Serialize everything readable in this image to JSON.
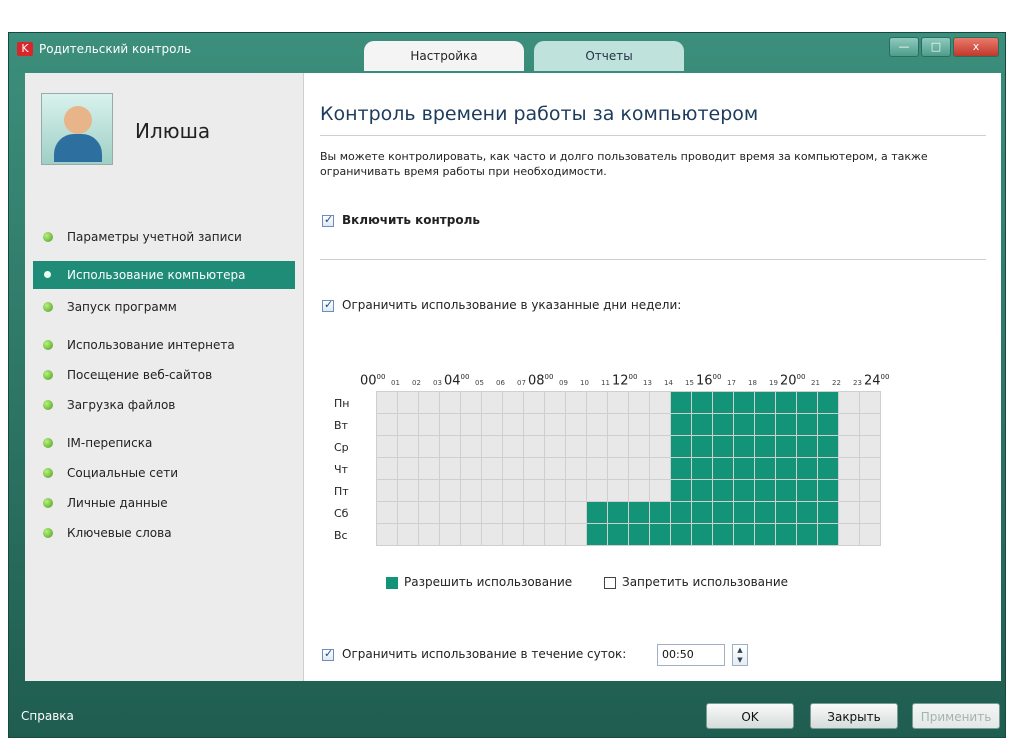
{
  "window": {
    "title": "Родительский контроль",
    "tabs": [
      {
        "label": "Настройка",
        "active": true
      },
      {
        "label": "Отчеты",
        "active": false
      }
    ],
    "buttons": {
      "minimize": "—",
      "maximize": "□",
      "close": "x"
    }
  },
  "sidebar": {
    "user_name": "Илюша",
    "items": [
      {
        "label": "Параметры учетной записи",
        "active": false
      },
      {
        "label": "Использование компьютера",
        "active": true
      },
      {
        "label": "Запуск программ",
        "active": false
      },
      {
        "label": "Использование интернета",
        "active": false
      },
      {
        "label": "Посещение веб-сайтов",
        "active": false
      },
      {
        "label": "Загрузка файлов",
        "active": false
      },
      {
        "label": "IM-переписка",
        "active": false
      },
      {
        "label": "Социальные сети",
        "active": false
      },
      {
        "label": "Личные данные",
        "active": false
      },
      {
        "label": "Ключевые слова",
        "active": false
      }
    ]
  },
  "main": {
    "heading": "Контроль времени работы за компьютером",
    "description": "Вы можете контролировать, как часто и долго пользователь проводит время за компьютером, а также ограничивать время работы при необходимости.",
    "enable_control": {
      "label": "Включить контроль",
      "checked": true
    },
    "limit_days": {
      "label": "Ограничить использование в указанные дни недели:",
      "checked": true
    },
    "schedule": {
      "hour_labels_big": [
        "00",
        "04",
        "08",
        "12",
        "16",
        "20",
        "24"
      ],
      "hour_sup": "00",
      "hour_labels_small": [
        "01",
        "02",
        "03",
        "05",
        "06",
        "07",
        "09",
        "10",
        "11",
        "13",
        "14",
        "15",
        "17",
        "18",
        "19",
        "21",
        "22",
        "23"
      ],
      "days": [
        "Пн",
        "Вт",
        "Ср",
        "Чт",
        "Пт",
        "Сб",
        "Вс"
      ],
      "allowed": [
        [
          14,
          21
        ],
        [
          14,
          21
        ],
        [
          14,
          21
        ],
        [
          14,
          21
        ],
        [
          14,
          21
        ],
        [
          10,
          21
        ],
        [
          10,
          21
        ]
      ]
    },
    "legend": {
      "allow": "Разрешить использование",
      "deny": "Запретить использование"
    },
    "limit_daily": {
      "label": "Ограничить использование в течение суток:",
      "checked": true,
      "value": "00:50"
    }
  },
  "footer": {
    "help": "Справка",
    "ok": "OK",
    "close": "Закрыть",
    "apply": "Применить"
  },
  "colors": {
    "accent": "#139478",
    "title_bar": "#2e7a69"
  }
}
